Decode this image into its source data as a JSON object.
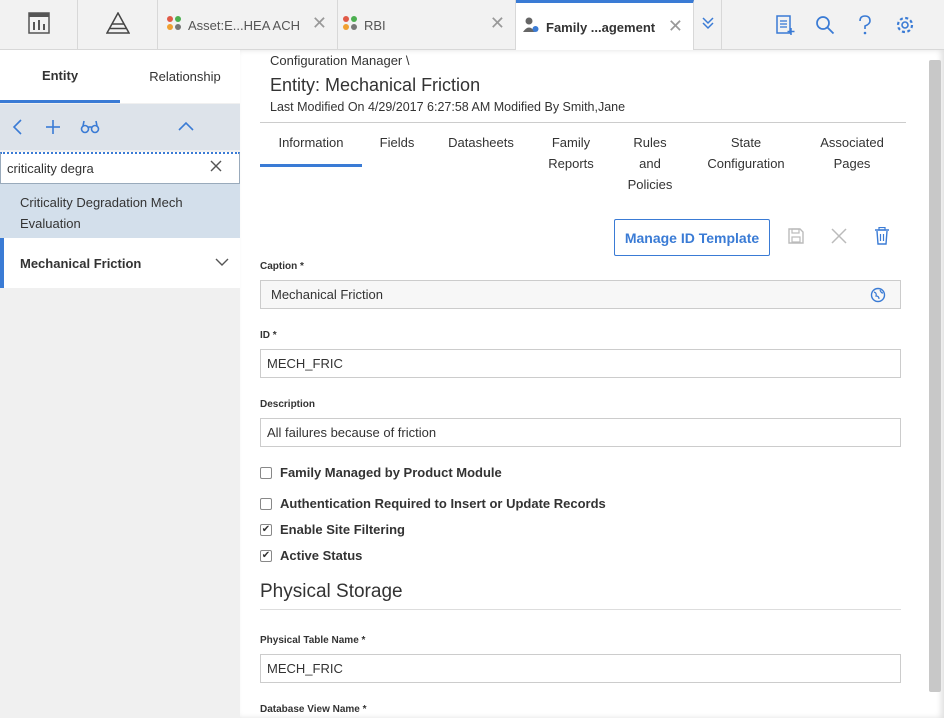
{
  "topbar": {
    "tabs": [
      {
        "label": "Asset:E...HEA ACH"
      },
      {
        "label": "RBI"
      },
      {
        "label": "Family ...agement"
      }
    ],
    "icons": [
      "dashboard-icon",
      "pyramid-icon",
      "overflow-chevron-icon",
      "new-record-icon",
      "search-icon",
      "help-icon",
      "settings-icon"
    ]
  },
  "left": {
    "tabs": [
      {
        "label": "Entity"
      },
      {
        "label": "Relationship"
      }
    ],
    "search_value": "criticality degra",
    "result_label": "Criticality Degradation Mech Evaluation",
    "selected_item": "Mechanical Friction"
  },
  "main": {
    "breadcrumb": "Configuration Manager \\",
    "title": "Entity: Mechanical Friction",
    "modified": "Last Modified On 4/29/2017 6:27:58 AM Modified By Smith,Jane",
    "subtabs": [
      {
        "line1": "Information",
        "line2": "",
        "line3": ""
      },
      {
        "line1": "Fields",
        "line2": "",
        "line3": ""
      },
      {
        "line1": "Datasheets",
        "line2": "",
        "line3": ""
      },
      {
        "line1": "Family",
        "line2": "Reports",
        "line3": ""
      },
      {
        "line1": "Rules",
        "line2": "and",
        "line3": "Policies"
      },
      {
        "line1": "State",
        "line2": "Configuration",
        "line3": ""
      },
      {
        "line1": "Associated",
        "line2": "Pages",
        "line3": ""
      }
    ],
    "manage_button": "Manage ID Template",
    "fields": {
      "caption_label": "Caption *",
      "caption_value": "Mechanical Friction",
      "id_label": "ID *",
      "id_value": "MECH_FRIC",
      "description_label": "Description",
      "description_value": "All failures because of friction"
    },
    "checkboxes": [
      {
        "label": "Family Managed by Product Module",
        "checked": false
      },
      {
        "label": "Authentication Required to Insert or Update Records",
        "checked": false
      },
      {
        "label": "Enable Site Filtering",
        "checked": true
      },
      {
        "label": "Active Status",
        "checked": true
      }
    ],
    "section_title": "Physical Storage",
    "physical_table_label": "Physical Table Name *",
    "physical_table_value": "MECH_FRIC",
    "db_view_label": "Database View Name *"
  },
  "colors": {
    "accent": "#3a7bd5"
  }
}
